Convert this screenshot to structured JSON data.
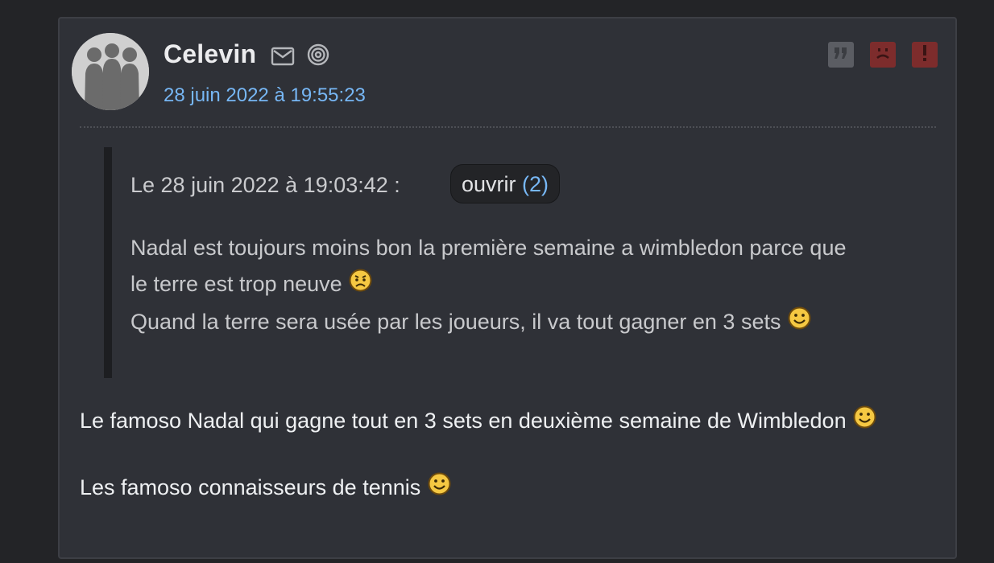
{
  "post": {
    "author": "Celevin",
    "date": "28 juin 2022 à 19:55:23",
    "icons": {
      "mail": "mail-icon",
      "spiral": "spiral-icon",
      "quote": "quote-icon",
      "sad": "sad-face-icon",
      "report": "exclamation-icon"
    },
    "quote": {
      "meta": "Le 28 juin 2022 à 19:03:42 :",
      "open_label": "ouvrir",
      "open_count": "(2)",
      "line1": "Nadal est toujours moins bon la première semaine a wimbledon parce que",
      "line2": "le terre est trop neuve",
      "line3": "Quand la terre sera usée par les joueurs, il va tout gagner en 3 sets"
    },
    "body": {
      "para1": "Le famoso Nadal qui gagne tout en 3 sets en deuxième semaine de Wimbledon",
      "para2": "Les famoso connaisseurs de tennis"
    },
    "colors": {
      "link": "#77b7f5",
      "background": "#2f3137",
      "danger": "#7d2c2c"
    }
  }
}
